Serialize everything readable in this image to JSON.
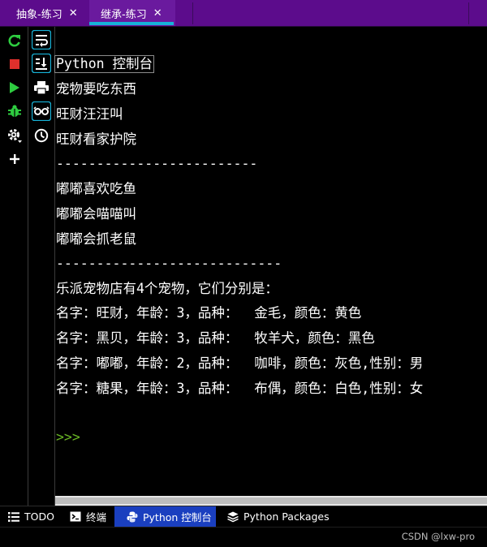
{
  "tabs": [
    {
      "label": "抽象-练习",
      "active": false
    },
    {
      "label": "继承-练习",
      "active": true
    }
  ],
  "toolbar_left": {
    "icons": [
      "rerun-icon",
      "stop-icon",
      "run-icon",
      "debug-icon",
      "settings-icon",
      "add-icon"
    ]
  },
  "toolbar_right": {
    "icons": [
      "soft-wrap-icon",
      "scroll-to-end-icon",
      "print-icon",
      "view-variables-icon",
      "history-icon"
    ]
  },
  "console": {
    "title": "Python 控制台",
    "lines": [
      "宠物要吃东西",
      "旺财汪汪叫",
      "旺财看家护院",
      "-------------------------",
      "嘟嘟喜欢吃鱼",
      "嘟嘟会喵喵叫",
      "嘟嘟会抓老鼠",
      "----------------------------",
      "乐派宠物店有4个宠物，它们分别是：",
      "名字：旺财，年龄：3，品种：  金毛，颜色：黄色",
      "名字：黑贝，年龄：3，品种：  牧羊犬，颜色：黑色",
      "名字：嘟嘟，年龄：2，品种：  咖啡，颜色：灰色,性别：男",
      "名字：糖果，年龄：3，品种：  布偶，颜色：白色,性别：女"
    ],
    "prompt": ">>>"
  },
  "bottom_tabs": [
    {
      "label": "TODO",
      "icon": "list-icon"
    },
    {
      "label": "终端",
      "icon": "terminal-icon"
    },
    {
      "label": "Python 控制台",
      "icon": "python-icon",
      "active": true
    },
    {
      "label": "Python Packages",
      "icon": "layers-icon"
    }
  ],
  "status": {
    "text": "CSDN @lxw-pro"
  },
  "colors": {
    "tab_bar": "#5c0c8c",
    "active_tab_underline": "#17b3d8",
    "active_bottom_tab": "#1a3fbf",
    "prompt": "#6ab825",
    "run_green": "#2ecc40",
    "stop_red": "#e0302c"
  }
}
